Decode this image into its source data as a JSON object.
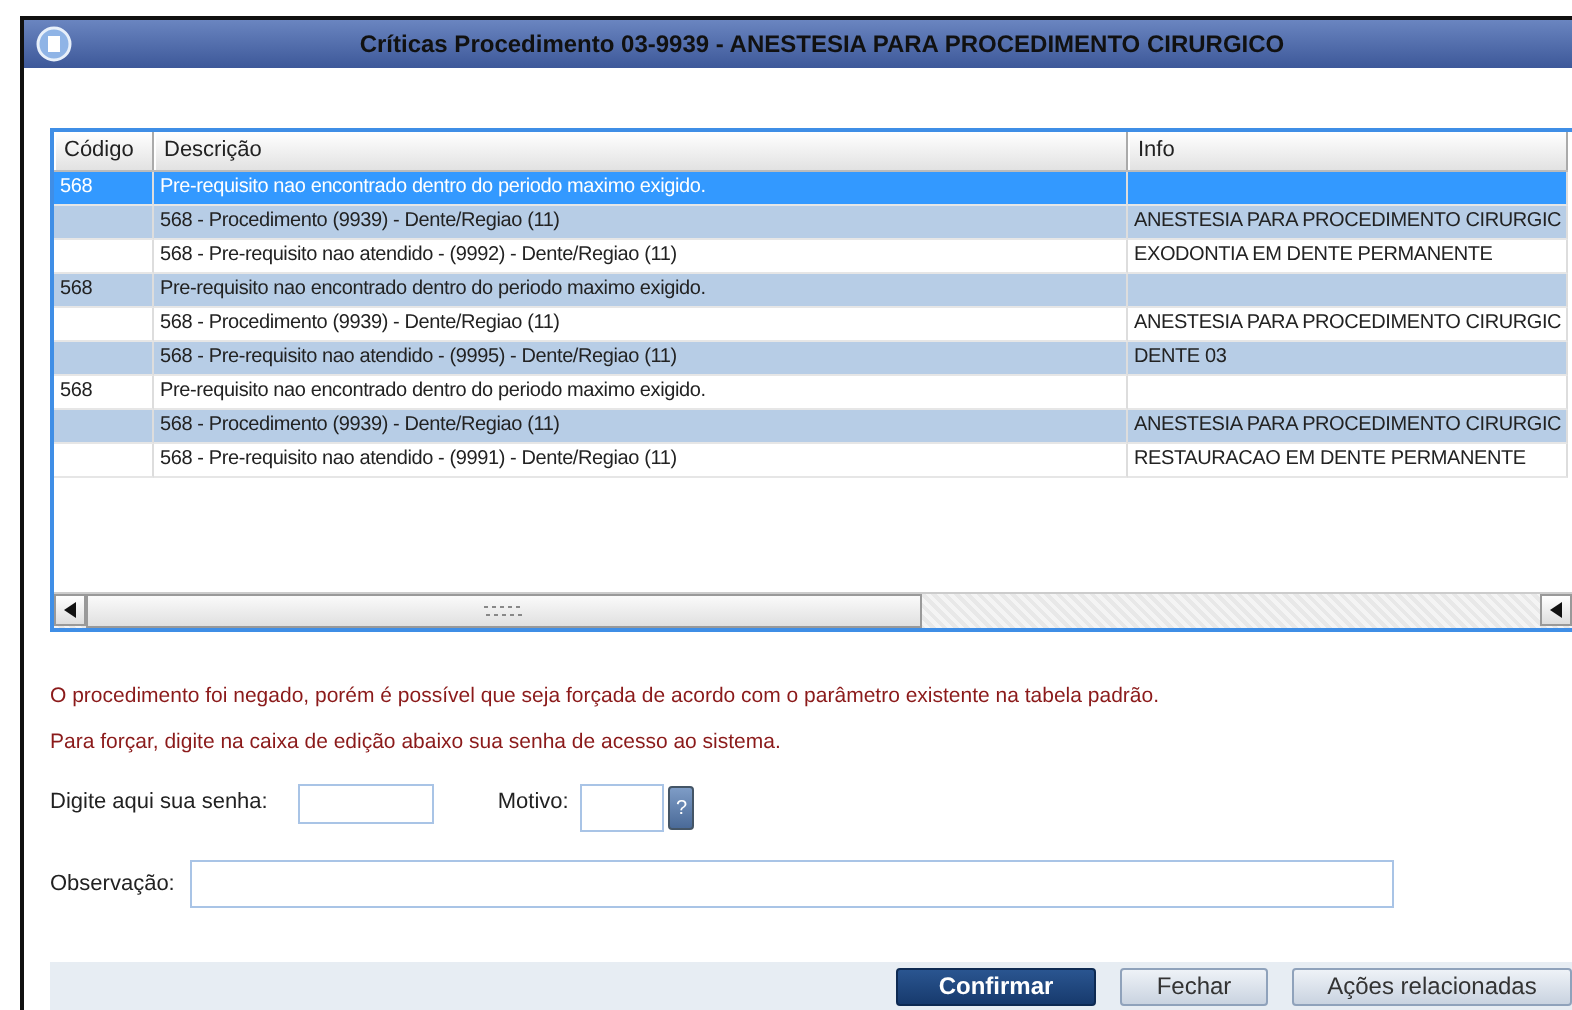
{
  "window": {
    "title": "Críticas Procedimento 03-9939 - ANESTESIA PARA PROCEDIMENTO CIRURGICO"
  },
  "table": {
    "columns": [
      "Código",
      "Descrição",
      "Info"
    ],
    "rows": [
      {
        "codigo": "568",
        "descricao": "Pre-requisito nao encontrado dentro do periodo maximo exigido.",
        "info": "",
        "selected": true
      },
      {
        "codigo": "",
        "descricao": "568 - Procedimento (9939) - Dente/Regiao (11)",
        "info": "ANESTESIA PARA PROCEDIMENTO CIRURGIC",
        "selected": false
      },
      {
        "codigo": "",
        "descricao": "568 - Pre-requisito nao atendido - (9992) - Dente/Regiao (11)",
        "info": "EXODONTIA EM DENTE PERMANENTE",
        "selected": false
      },
      {
        "codigo": "568",
        "descricao": "Pre-requisito nao encontrado dentro do periodo maximo exigido.",
        "info": "",
        "selected": false
      },
      {
        "codigo": "",
        "descricao": "568 - Procedimento (9939) - Dente/Regiao (11)",
        "info": "ANESTESIA PARA PROCEDIMENTO CIRURGIC",
        "selected": false
      },
      {
        "codigo": "",
        "descricao": "568 - Pre-requisito nao atendido - (9995) - Dente/Regiao (11)",
        "info": "DENTE 03",
        "selected": false
      },
      {
        "codigo": "568",
        "descricao": "Pre-requisito nao encontrado dentro do periodo maximo exigido.",
        "info": "",
        "selected": false
      },
      {
        "codigo": "",
        "descricao": "568 - Procedimento (9939) - Dente/Regiao (11)",
        "info": "ANESTESIA PARA PROCEDIMENTO CIRURGIC",
        "selected": false
      },
      {
        "codigo": "",
        "descricao": "568 - Pre-requisito nao atendido - (9991) - Dente/Regiao (11)",
        "info": "RESTAURACAO EM DENTE PERMANENTE",
        "selected": false
      }
    ]
  },
  "messages": [
    "O procedimento foi negado, porém é possível que seja forçada de acordo com o parâmetro existente na tabela padrão.",
    "Para forçar, digite na caixa de edição abaixo sua senha de acesso ao sistema."
  ],
  "form": {
    "password_label": "Digite aqui sua senha:",
    "motivo_label": "Motivo:",
    "help_button": "?",
    "observacao_label": "Observação:"
  },
  "buttons": [
    {
      "label": "Confirmar",
      "kind": "primary"
    },
    {
      "label": "Fechar",
      "kind": "secondary"
    },
    {
      "label": "Ações relacionadas",
      "kind": "secondary"
    }
  ]
}
